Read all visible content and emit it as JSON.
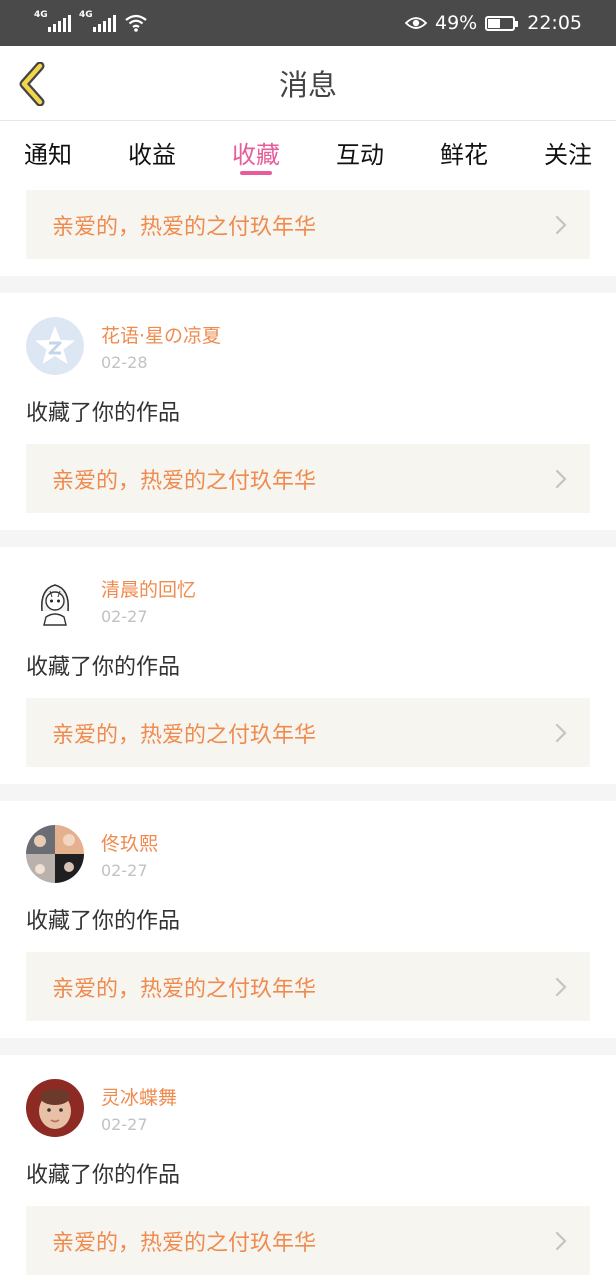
{
  "statusbar": {
    "net1": "4G",
    "net2": "4G",
    "battery": "49%",
    "battery_level": 0.49,
    "time": "22:05"
  },
  "header": {
    "title": "消息"
  },
  "tabs": [
    {
      "label": "通知"
    },
    {
      "label": "收益"
    },
    {
      "label": "收藏",
      "active": true
    },
    {
      "label": "互动"
    },
    {
      "label": "鲜花"
    },
    {
      "label": "关注"
    }
  ],
  "top_work": {
    "title": "亲爱的，热爱的之付玖年华"
  },
  "items": [
    {
      "name": "花语·星の凉夏",
      "date": "02-28",
      "action": "收藏了你的作品",
      "work": "亲爱的，热爱的之付玖年华",
      "avatar": "qzone-star-icon"
    },
    {
      "name": "清晨的回忆",
      "date": "02-27",
      "action": "收藏了你的作品",
      "work": "亲爱的，热爱的之付玖年华",
      "avatar": "anime-girl-sketch"
    },
    {
      "name": "佟玖熙",
      "date": "02-27",
      "action": "收藏了你的作品",
      "work": "亲爱的，热爱的之付玖年华",
      "avatar": "photo-collage"
    },
    {
      "name": "灵冰蝶舞",
      "date": "02-27",
      "action": "收藏了你的作品",
      "work": "亲爱的，热爱的之付玖年华",
      "avatar": "baby-photo"
    }
  ],
  "colors": {
    "accent": "#e65d9a",
    "name": "#f08b50",
    "work_bg": "#f6f5ef"
  }
}
